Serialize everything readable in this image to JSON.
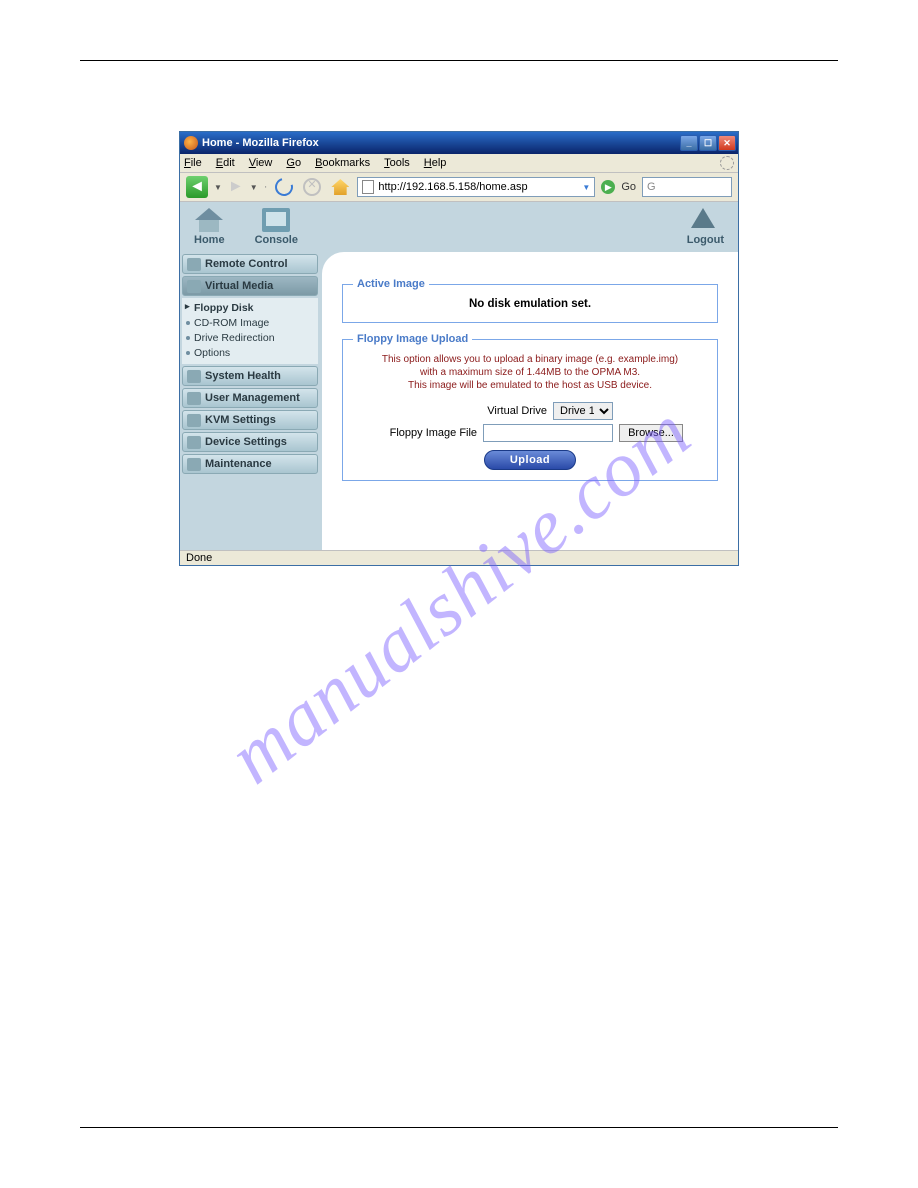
{
  "window": {
    "title": "Home - Mozilla Firefox",
    "menus": [
      "File",
      "Edit",
      "View",
      "Go",
      "Bookmarks",
      "Tools",
      "Help"
    ],
    "url": "http://192.168.5.158/home.asp",
    "go_label": "Go",
    "status": "Done"
  },
  "app_toolbar": {
    "home": "Home",
    "console": "Console",
    "logout": "Logout"
  },
  "sidebar": {
    "sections": [
      {
        "label": "Remote Control"
      },
      {
        "label": "Virtual Media",
        "selected": true,
        "sub": [
          {
            "label": "Floppy Disk",
            "current": true
          },
          {
            "label": "CD-ROM Image"
          },
          {
            "label": "Drive Redirection"
          },
          {
            "label": "Options"
          }
        ]
      },
      {
        "label": "System Health"
      },
      {
        "label": "User Management"
      },
      {
        "label": "KVM Settings"
      },
      {
        "label": "Device Settings"
      },
      {
        "label": "Maintenance"
      }
    ]
  },
  "content": {
    "active_legend": "Active Image",
    "active_text": "No disk emulation set.",
    "upload_legend": "Floppy Image Upload",
    "upload_desc_l1": "This option allows you to upload a binary image (e.g. example.img)",
    "upload_desc_l2": "with a maximum size of 1.44MB to the OPMA M3.",
    "upload_desc_l3": "This image will be emulated to the host as USB device.",
    "vd_label": "Virtual Drive",
    "vd_value": "Drive 1",
    "file_label": "Floppy Image File",
    "browse_label": "Browse...",
    "upload_btn": "Upload"
  },
  "watermark": "manualshive.com"
}
